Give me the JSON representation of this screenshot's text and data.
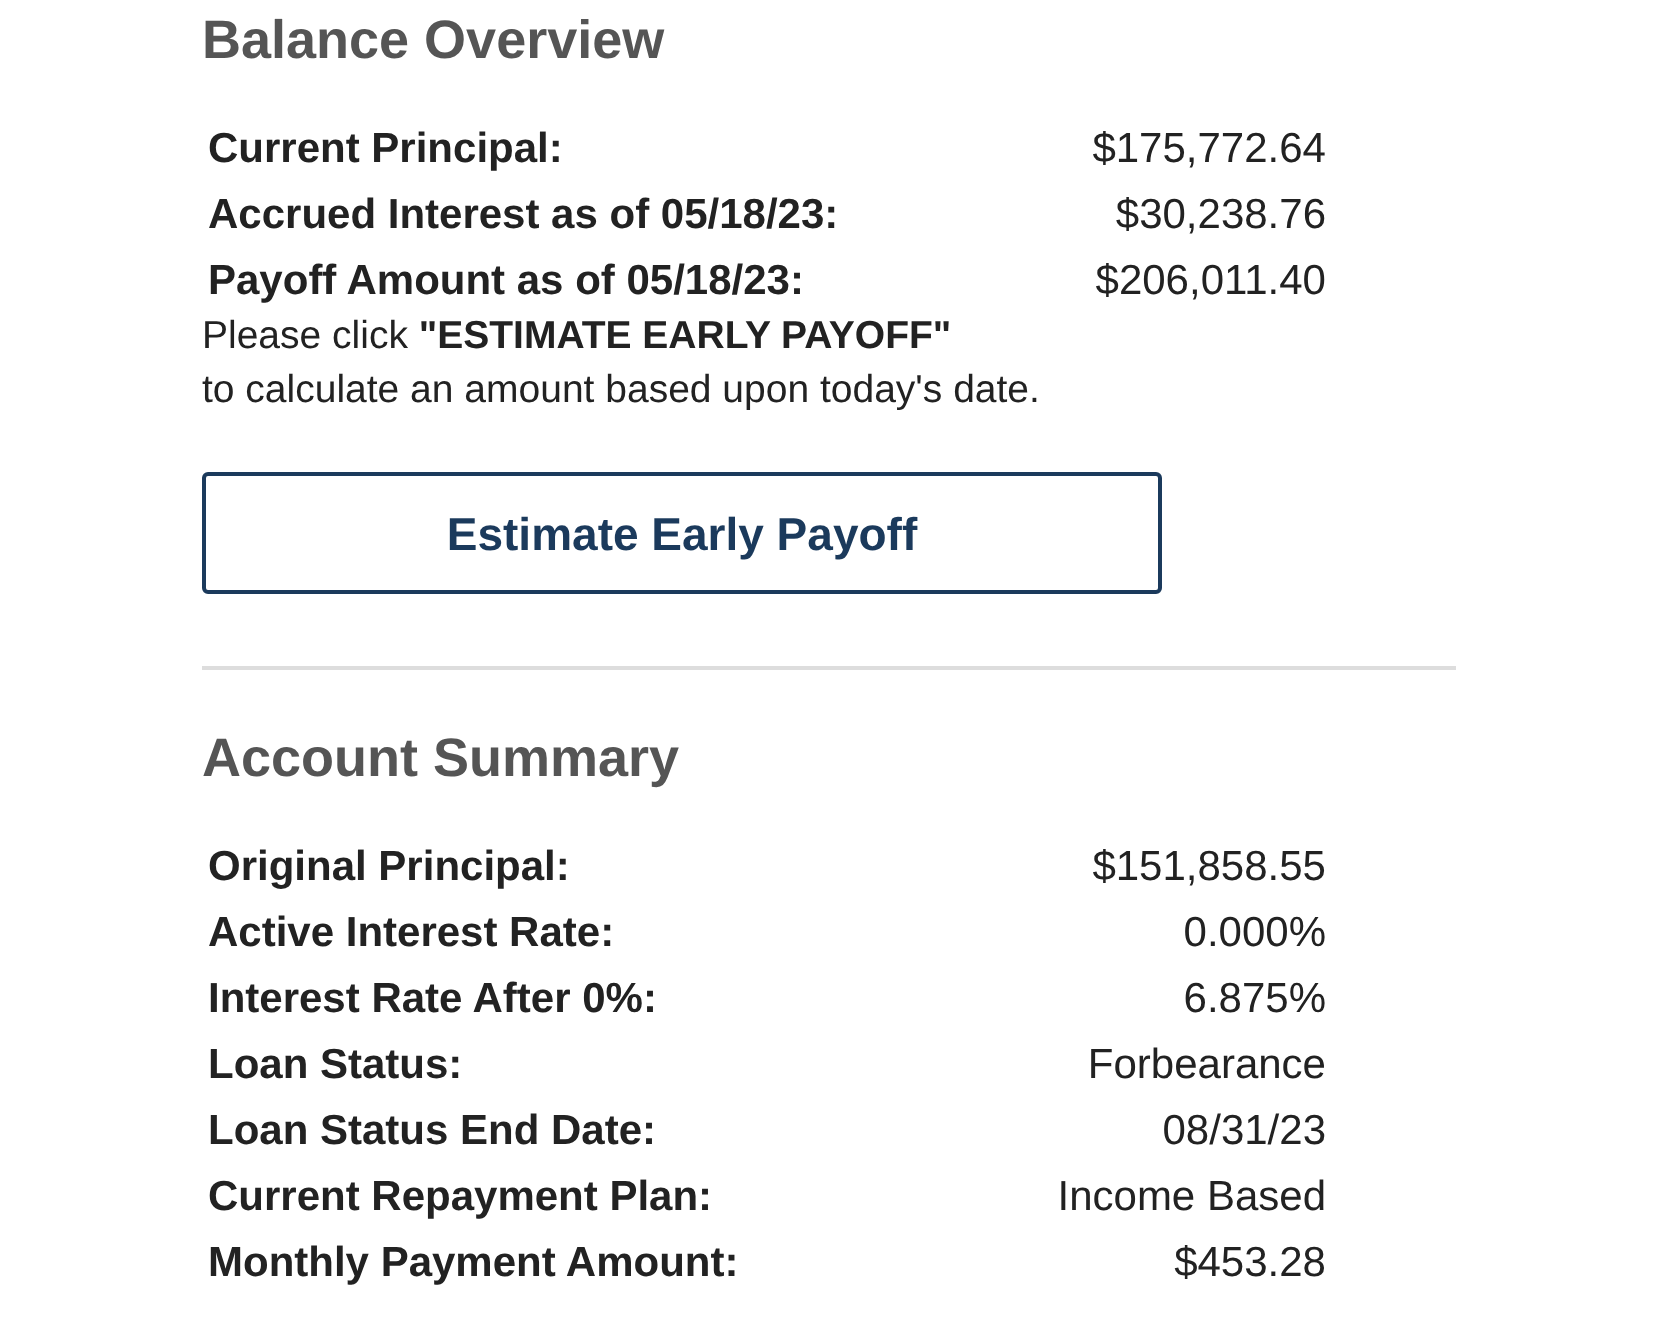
{
  "balance_overview": {
    "title": "Balance Overview",
    "rows": [
      {
        "label": "Current Principal:",
        "value": "$175,772.64"
      },
      {
        "label": "Accrued Interest as of 05/18/23:",
        "value": "$30,238.76"
      },
      {
        "label": "Payoff Amount as of 05/18/23:",
        "value": "$206,011.40"
      }
    ],
    "note": "Please click **\"ESTIMATE EARLY PAYOFF\"**\nto calculate an amount based upon today's date.",
    "button": "Estimate Early Payoff"
  },
  "account_summary": {
    "title": "Account Summary",
    "rows": [
      {
        "label": "Original Principal:",
        "value": "$151,858.55"
      },
      {
        "label": "Active Interest Rate:",
        "value": "0.000%"
      },
      {
        "label": "Interest Rate After 0%:",
        "value": "6.875%"
      },
      {
        "label": "Loan Status:",
        "value": "Forbearance"
      },
      {
        "label": "Loan Status End Date:",
        "value": "08/31/23"
      },
      {
        "label": "Current Repayment Plan:",
        "value": "Income Based"
      },
      {
        "label": "Monthly Payment Amount:",
        "value": "$453.28"
      }
    ]
  }
}
